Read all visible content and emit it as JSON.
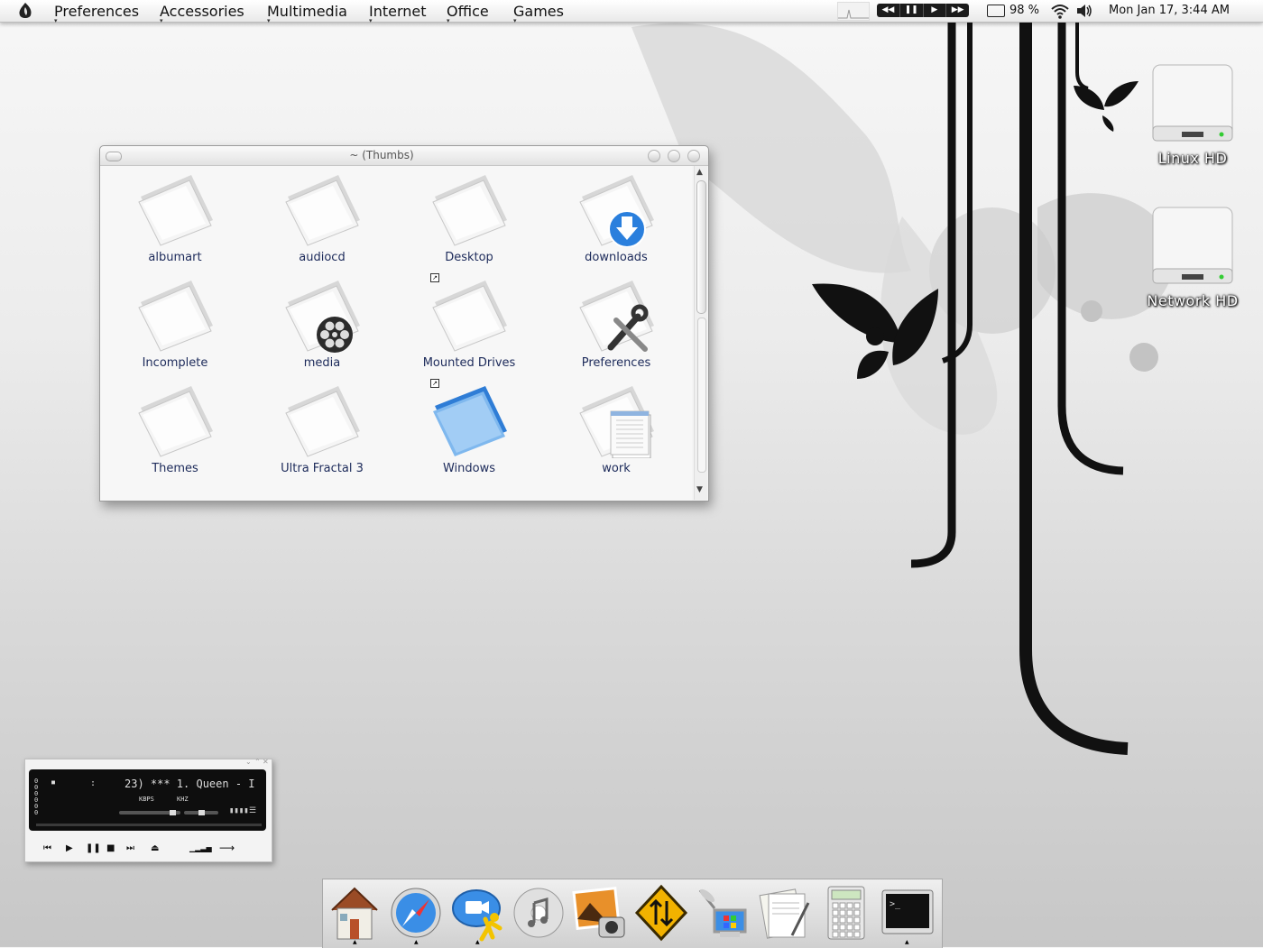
{
  "panel": {
    "menus": [
      "Preferences",
      "Accessories",
      "Multimedia",
      "Internet",
      "Office",
      "Games"
    ],
    "media_controls": [
      "◀◀",
      "❚❚",
      "▶",
      "▶▶"
    ],
    "battery": "98 %",
    "clock": "Mon Jan 17,  3:44 AM"
  },
  "desktop": {
    "drives": [
      {
        "label": "Linux HD"
      },
      {
        "label": "Network HD"
      }
    ]
  },
  "window": {
    "title": "~ (Thumbs)",
    "items": [
      {
        "label": "albumart",
        "icon": "folder-icon"
      },
      {
        "label": "audiocd",
        "icon": "folder-icon"
      },
      {
        "label": "Desktop",
        "icon": "folder-icon"
      },
      {
        "label": "downloads",
        "icon": "downloads-folder-icon"
      },
      {
        "label": "Incomplete",
        "icon": "folder-icon"
      },
      {
        "label": "media",
        "icon": "media-folder-icon"
      },
      {
        "label": "Mounted Drives",
        "icon": "folder-icon"
      },
      {
        "label": "Preferences",
        "icon": "preferences-folder-icon"
      },
      {
        "label": "Themes",
        "icon": "folder-icon"
      },
      {
        "label": "Ultra Fractal 3",
        "icon": "folder-icon"
      },
      {
        "label": "Windows",
        "icon": "windows-folder-icon"
      },
      {
        "label": "work",
        "icon": "work-folder-icon"
      }
    ]
  },
  "player": {
    "track": "23)  ***  1. Queen - I",
    "kbps_label": "KBPS",
    "khz_label": "KHZ",
    "buttons": [
      "⏮",
      "▶",
      "❚❚",
      "■",
      "⏭",
      "⏏"
    ]
  },
  "dock": {
    "apps": [
      "home-icon",
      "safari-icon",
      "ichat-icon",
      "itunes-icon",
      "iphoto-icon",
      "transmit-icon",
      "network-icon",
      "textedit-icon",
      "calculator-icon",
      "terminal-icon"
    ]
  },
  "colors": {
    "label_text": "#1c2a5a",
    "folder_blue": "#3a8ee6"
  }
}
